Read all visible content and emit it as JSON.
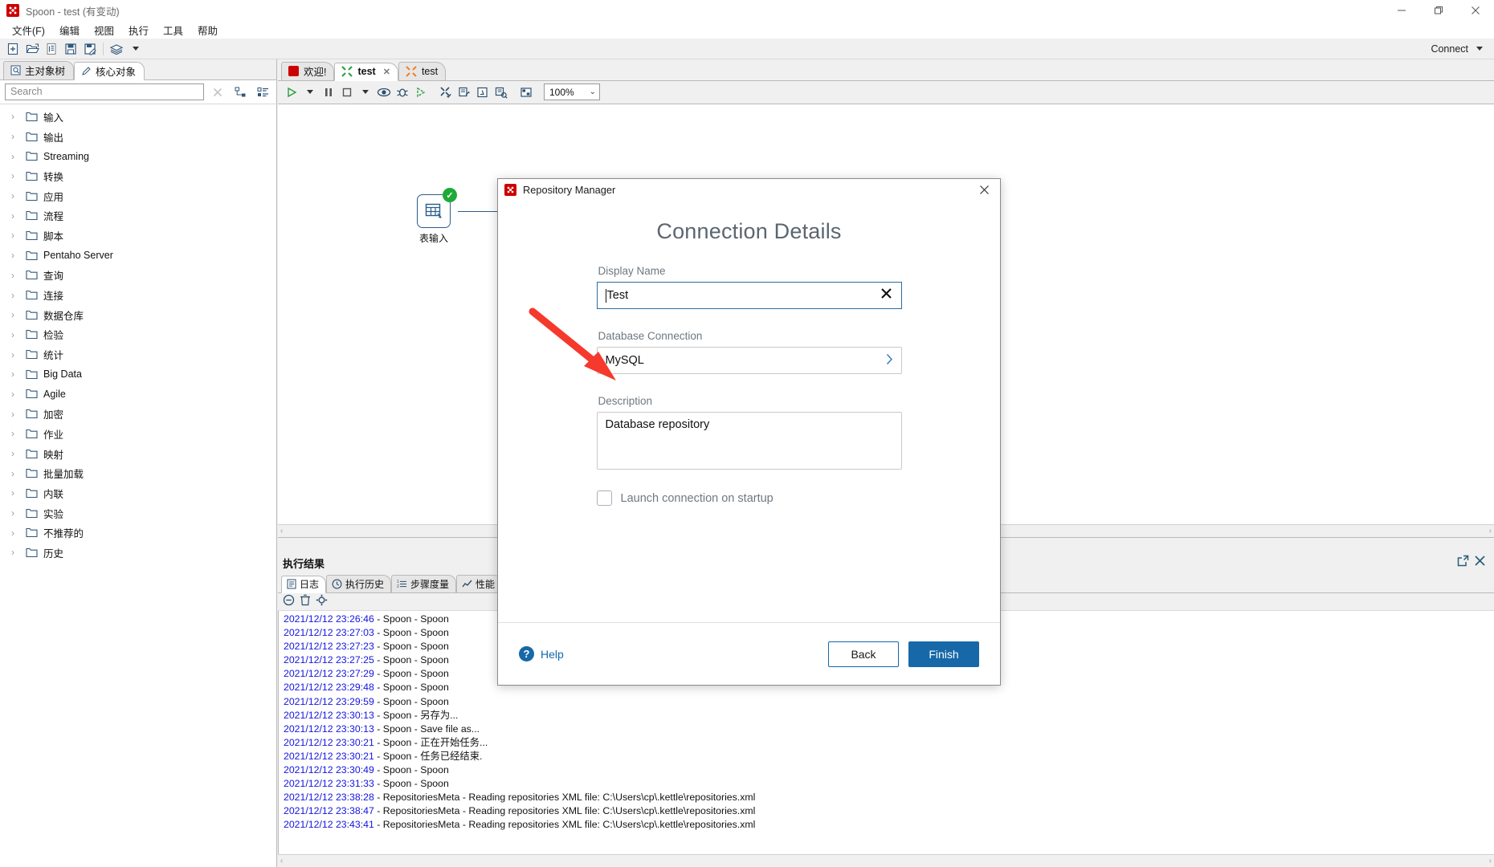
{
  "window": {
    "title": "Spoon - test (有变动)",
    "logo_icon": "spoon-logo-icon",
    "minimize_label": "—",
    "maximize_label": "❐",
    "close_label": "✕"
  },
  "menubar": {
    "items": [
      {
        "label": "文件(F)",
        "name": "menu-file"
      },
      {
        "label": "编辑",
        "name": "menu-edit"
      },
      {
        "label": "视图",
        "name": "menu-view"
      },
      {
        "label": "执行",
        "name": "menu-run"
      },
      {
        "label": "工具",
        "name": "menu-tools"
      },
      {
        "label": "帮助",
        "name": "menu-help"
      }
    ]
  },
  "toolbar": {
    "icons": [
      "new-file-icon",
      "open-folder-icon",
      "explore-icon",
      "save-icon",
      "save-as-icon",
      "layers-icon",
      "layers-dropdown-icon"
    ],
    "connect_label": "Connect"
  },
  "sidebar": {
    "tabs": [
      {
        "label": "主对象树",
        "icon": "tree-view-icon",
        "active": false
      },
      {
        "label": "核心对象",
        "icon": "pencil-icon",
        "active": true
      }
    ],
    "search": {
      "placeholder": "Search",
      "value": "",
      "clear_icon": "clear-x-icon"
    },
    "view_icons": [
      "expand-all-icon",
      "collapse-all-icon"
    ],
    "tree_items": [
      "输入",
      "输出",
      "Streaming",
      "转换",
      "应用",
      "流程",
      "脚本",
      "Pentaho Server",
      "查询",
      "连接",
      "数据仓库",
      "检验",
      "统计",
      "Big Data",
      "Agile",
      "加密",
      "作业",
      "映射",
      "批量加载",
      "内联",
      "实验",
      "不推荐的",
      "历史"
    ]
  },
  "canvas": {
    "tabs": [
      {
        "label": "欢迎!",
        "icon": "spoon-logo-icon",
        "active": false,
        "closable": false
      },
      {
        "label": "test",
        "icon": "transformation-icon",
        "active": true,
        "closable": true
      },
      {
        "label": "test",
        "icon": "job-icon",
        "active": false,
        "closable": false
      }
    ],
    "toolbar_icons": [
      "run-icon",
      "run-dropdown-icon",
      "pause-icon",
      "stop-icon",
      "stop-dropdown-icon",
      "preview-icon",
      "debug-icon",
      "replay-icon",
      "verify-icon",
      "analyze-impact-icon",
      "sql-icon",
      "inspect-icon",
      "grid-icon"
    ],
    "zoom_level": "100%",
    "zoom_dropdown_icon": "chevron-down-icon",
    "step": {
      "label": "表输入",
      "icon": "table-input-icon",
      "status_icon": "success-check-icon"
    },
    "scroll_left_icon": "‹",
    "scroll_right_icon": "›"
  },
  "results": {
    "title": "执行结果",
    "header_icons": [
      "detach-icon",
      "close-icon"
    ],
    "tabs": [
      {
        "label": "日志",
        "icon": "log-icon",
        "active": true
      },
      {
        "label": "执行历史",
        "icon": "clock-icon",
        "active": false
      },
      {
        "label": "步骤度量",
        "icon": "list-numbered-icon",
        "active": false
      },
      {
        "label": "性能",
        "icon": "chart-icon",
        "active": false
      }
    ],
    "log_toolbar_icons": [
      "clear-log-icon",
      "delete-icon",
      "settings-gear-icon"
    ],
    "log_lines": [
      {
        "ts": "2021/12/12 23:26:46",
        "msg": " - Spoon - Spoon"
      },
      {
        "ts": "2021/12/12 23:27:03",
        "msg": " - Spoon - Spoon"
      },
      {
        "ts": "2021/12/12 23:27:23",
        "msg": " - Spoon - Spoon"
      },
      {
        "ts": "2021/12/12 23:27:25",
        "msg": " - Spoon - Spoon"
      },
      {
        "ts": "2021/12/12 23:27:29",
        "msg": " - Spoon - Spoon"
      },
      {
        "ts": "2021/12/12 23:29:48",
        "msg": " - Spoon - Spoon"
      },
      {
        "ts": "2021/12/12 23:29:59",
        "msg": " - Spoon - Spoon"
      },
      {
        "ts": "2021/12/12 23:30:13",
        "msg": " - Spoon - 另存为..."
      },
      {
        "ts": "2021/12/12 23:30:13",
        "msg": " - Spoon - Save file as..."
      },
      {
        "ts": "2021/12/12 23:30:21",
        "msg": " - Spoon - 正在开始任务..."
      },
      {
        "ts": "2021/12/12 23:30:21",
        "msg": " - Spoon - 任务已经结束."
      },
      {
        "ts": "2021/12/12 23:30:49",
        "msg": " - Spoon - Spoon"
      },
      {
        "ts": "2021/12/12 23:31:33",
        "msg": " - Spoon - Spoon"
      },
      {
        "ts": "2021/12/12 23:38:28",
        "msg": " - RepositoriesMeta - Reading repositories XML file: C:\\Users\\cp\\.kettle\\repositories.xml"
      },
      {
        "ts": "2021/12/12 23:38:47",
        "msg": " - RepositoriesMeta - Reading repositories XML file: C:\\Users\\cp\\.kettle\\repositories.xml"
      },
      {
        "ts": "2021/12/12 23:43:41",
        "msg": " - RepositoriesMeta - Reading repositories XML file: C:\\Users\\cp\\.kettle\\repositories.xml"
      }
    ],
    "scroll_left_icon": "‹",
    "scroll_right_icon": "›"
  },
  "dialog": {
    "title": "Repository Manager",
    "logo_icon": "spoon-logo-icon",
    "close_icon": "close-icon",
    "heading": "Connection Details",
    "fields": {
      "display_name": {
        "label": "Display Name",
        "value": "Test",
        "placeholder": "",
        "clear_icon": "clear-x-icon"
      },
      "database_connection": {
        "label": "Database Connection",
        "value": "MySQL",
        "chevron_icon": "chevron-right-icon"
      },
      "description": {
        "label": "Description",
        "value": "Database repository",
        "placeholder": ""
      }
    },
    "checkbox": {
      "label": "Launch connection on startup",
      "checked": false
    },
    "help": {
      "label": "Help",
      "icon": "help-question-icon"
    },
    "buttons": {
      "back": "Back",
      "finish": "Finish"
    },
    "accent_color": "#1668a8"
  },
  "annotation": {
    "arrow_color": "#f5392c",
    "arrow_icon": "red-arrow-pointer"
  }
}
